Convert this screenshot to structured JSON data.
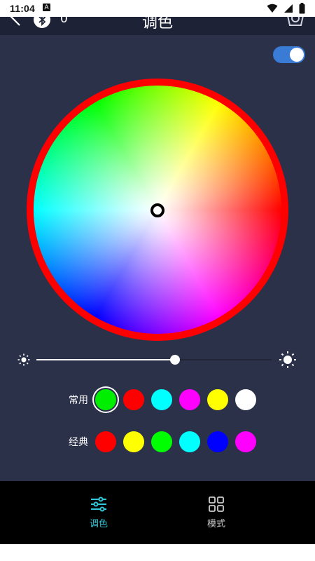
{
  "status_bar": {
    "time": "11:04",
    "notification_glyph": "A"
  },
  "header": {
    "title": "调色",
    "device_count": "0"
  },
  "power_toggle": {
    "state": "on"
  },
  "brightness": {
    "level_percent": 59
  },
  "rows": {
    "common": {
      "label": "常用",
      "colors": [
        "#00ee00",
        "#ff0000",
        "#00ffff",
        "#ff00ff",
        "#ffff00",
        "#ffffff"
      ],
      "selected_index": 0
    },
    "classic": {
      "label": "经典",
      "colors": [
        "#ff0000",
        "#ffff00",
        "#00ff00",
        "#00ffff",
        "#0000ff",
        "#ff00ff"
      ]
    }
  },
  "nav": {
    "tabs": [
      {
        "label": "调色",
        "icon": "sliders-icon",
        "active": true
      },
      {
        "label": "模式",
        "icon": "grid-icon",
        "active": false
      }
    ],
    "active_color": "#30c8d8",
    "inactive_color": "#cccccc"
  },
  "colors": {
    "background": "#2c314a",
    "header": "#1e2236",
    "toggle_on": "#3a7bd5",
    "ring": "#ff0000"
  }
}
